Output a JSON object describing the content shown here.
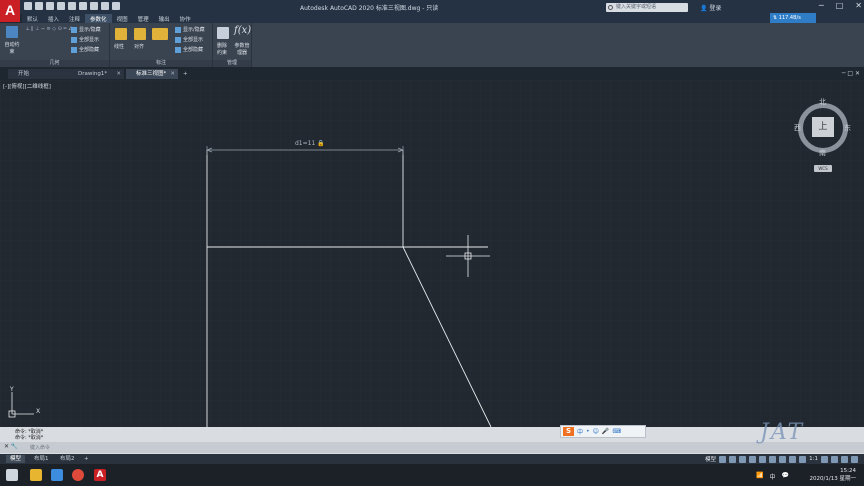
{
  "app": {
    "logo_letter": "A",
    "window_title": "Autodesk AutoCAD 2020    标准三视图.dwg - 只读",
    "search_placeholder": "键入关键字或短语",
    "user_label": "登录",
    "connect_label": "117.4B/s"
  },
  "ribbon": {
    "tabs": [
      "默认",
      "插入",
      "注释",
      "参数化",
      "视图",
      "管理",
      "输出",
      "协作"
    ],
    "active_tab": "参数化",
    "panels": {
      "geometry": {
        "label": "几何",
        "auto_constrain": "自动约束",
        "show_hide": "显示/隐藏",
        "show_all": "全部显示",
        "hide_all": "全部隐藏"
      },
      "dimensional": {
        "label": "标注",
        "linear": "线性",
        "aligned": "对齐",
        "show_hide": "显示/隐藏",
        "show_all": "全部显示",
        "hide_all": "全部隐藏"
      },
      "manage": {
        "label": "管理",
        "delete_constraints": "删除约束",
        "param_manager": "参数管理器"
      }
    }
  },
  "file_tabs": [
    {
      "label": "开始"
    },
    {
      "label": "Drawing1*"
    },
    {
      "label": "标准三视图*"
    }
  ],
  "viewport": {
    "label": "[-][俯视][二维线框]",
    "dimension_text": "d1=11"
  },
  "viewcube": {
    "north": "北",
    "south": "南",
    "east": "东",
    "west": "西",
    "face": "上",
    "wcs": "WCS"
  },
  "ucs": {
    "x": "X",
    "y": "Y"
  },
  "command": {
    "history": [
      "命令: *取消*",
      "命令: *取消*"
    ],
    "placeholder": "键入命令"
  },
  "layout_tabs": [
    "模型",
    "布局1",
    "布局2"
  ],
  "status_bar": {
    "model_label": "模型",
    "scale": "1:1"
  },
  "watermark": "JAT",
  "taskbar": {
    "time": "15:24",
    "date": "2020/1/13 星期一",
    "ime_char": "中",
    "input_mode": "中"
  },
  "colors": {
    "accent": "#c91f25",
    "ribbon_active": "#3e5065",
    "canvas": "#212830"
  }
}
